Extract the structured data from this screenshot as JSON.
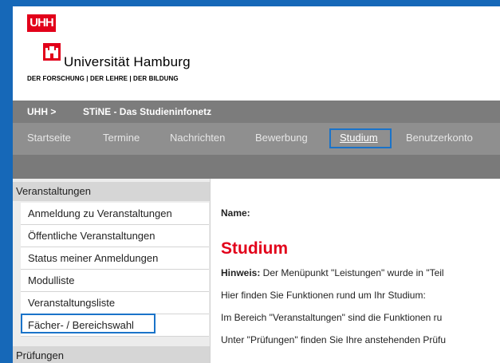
{
  "header": {
    "logo_mark": "UHH",
    "university_name": "Universität Hamburg",
    "tagline": "DER FORSCHUNG | DER LEHRE | DER BILDUNG"
  },
  "breadcrumb": {
    "home": "UHH >",
    "site": "STiNE - Das Studieninfonetz"
  },
  "nav": {
    "items": [
      "Startseite",
      "Termine",
      "Nachrichten",
      "Bewerbung",
      "Studium",
      "Benutzerkonto"
    ],
    "active": "Studium"
  },
  "sidebar": {
    "section1": "Veranstaltungen",
    "items": [
      "Anmeldung zu Veranstaltungen",
      "Öffentliche Veranstaltungen",
      "Status meiner Anmeldungen",
      "Modulliste",
      "Veranstaltungsliste",
      "Fächer- / Bereichswahl"
    ],
    "section2": "Prüfungen"
  },
  "main": {
    "name_label": "Name:",
    "title": "Studium",
    "hint_label": "Hinweis:",
    "hint_text": " Der Menüpunkt \"Leistungen\" wurde in \"Teil",
    "line2": "Hier finden Sie Funktionen rund um Ihr Studium:",
    "line3": "Im Bereich \"Veranstaltungen\" sind die Funktionen ru",
    "line4": "Unter \"Prüfungen\" finden Sie Ihre anstehenden Prüfu"
  },
  "colors": {
    "brand_red": "#e2001a",
    "highlight_blue": "#1a73c9",
    "background_blue": "#1668b8"
  }
}
